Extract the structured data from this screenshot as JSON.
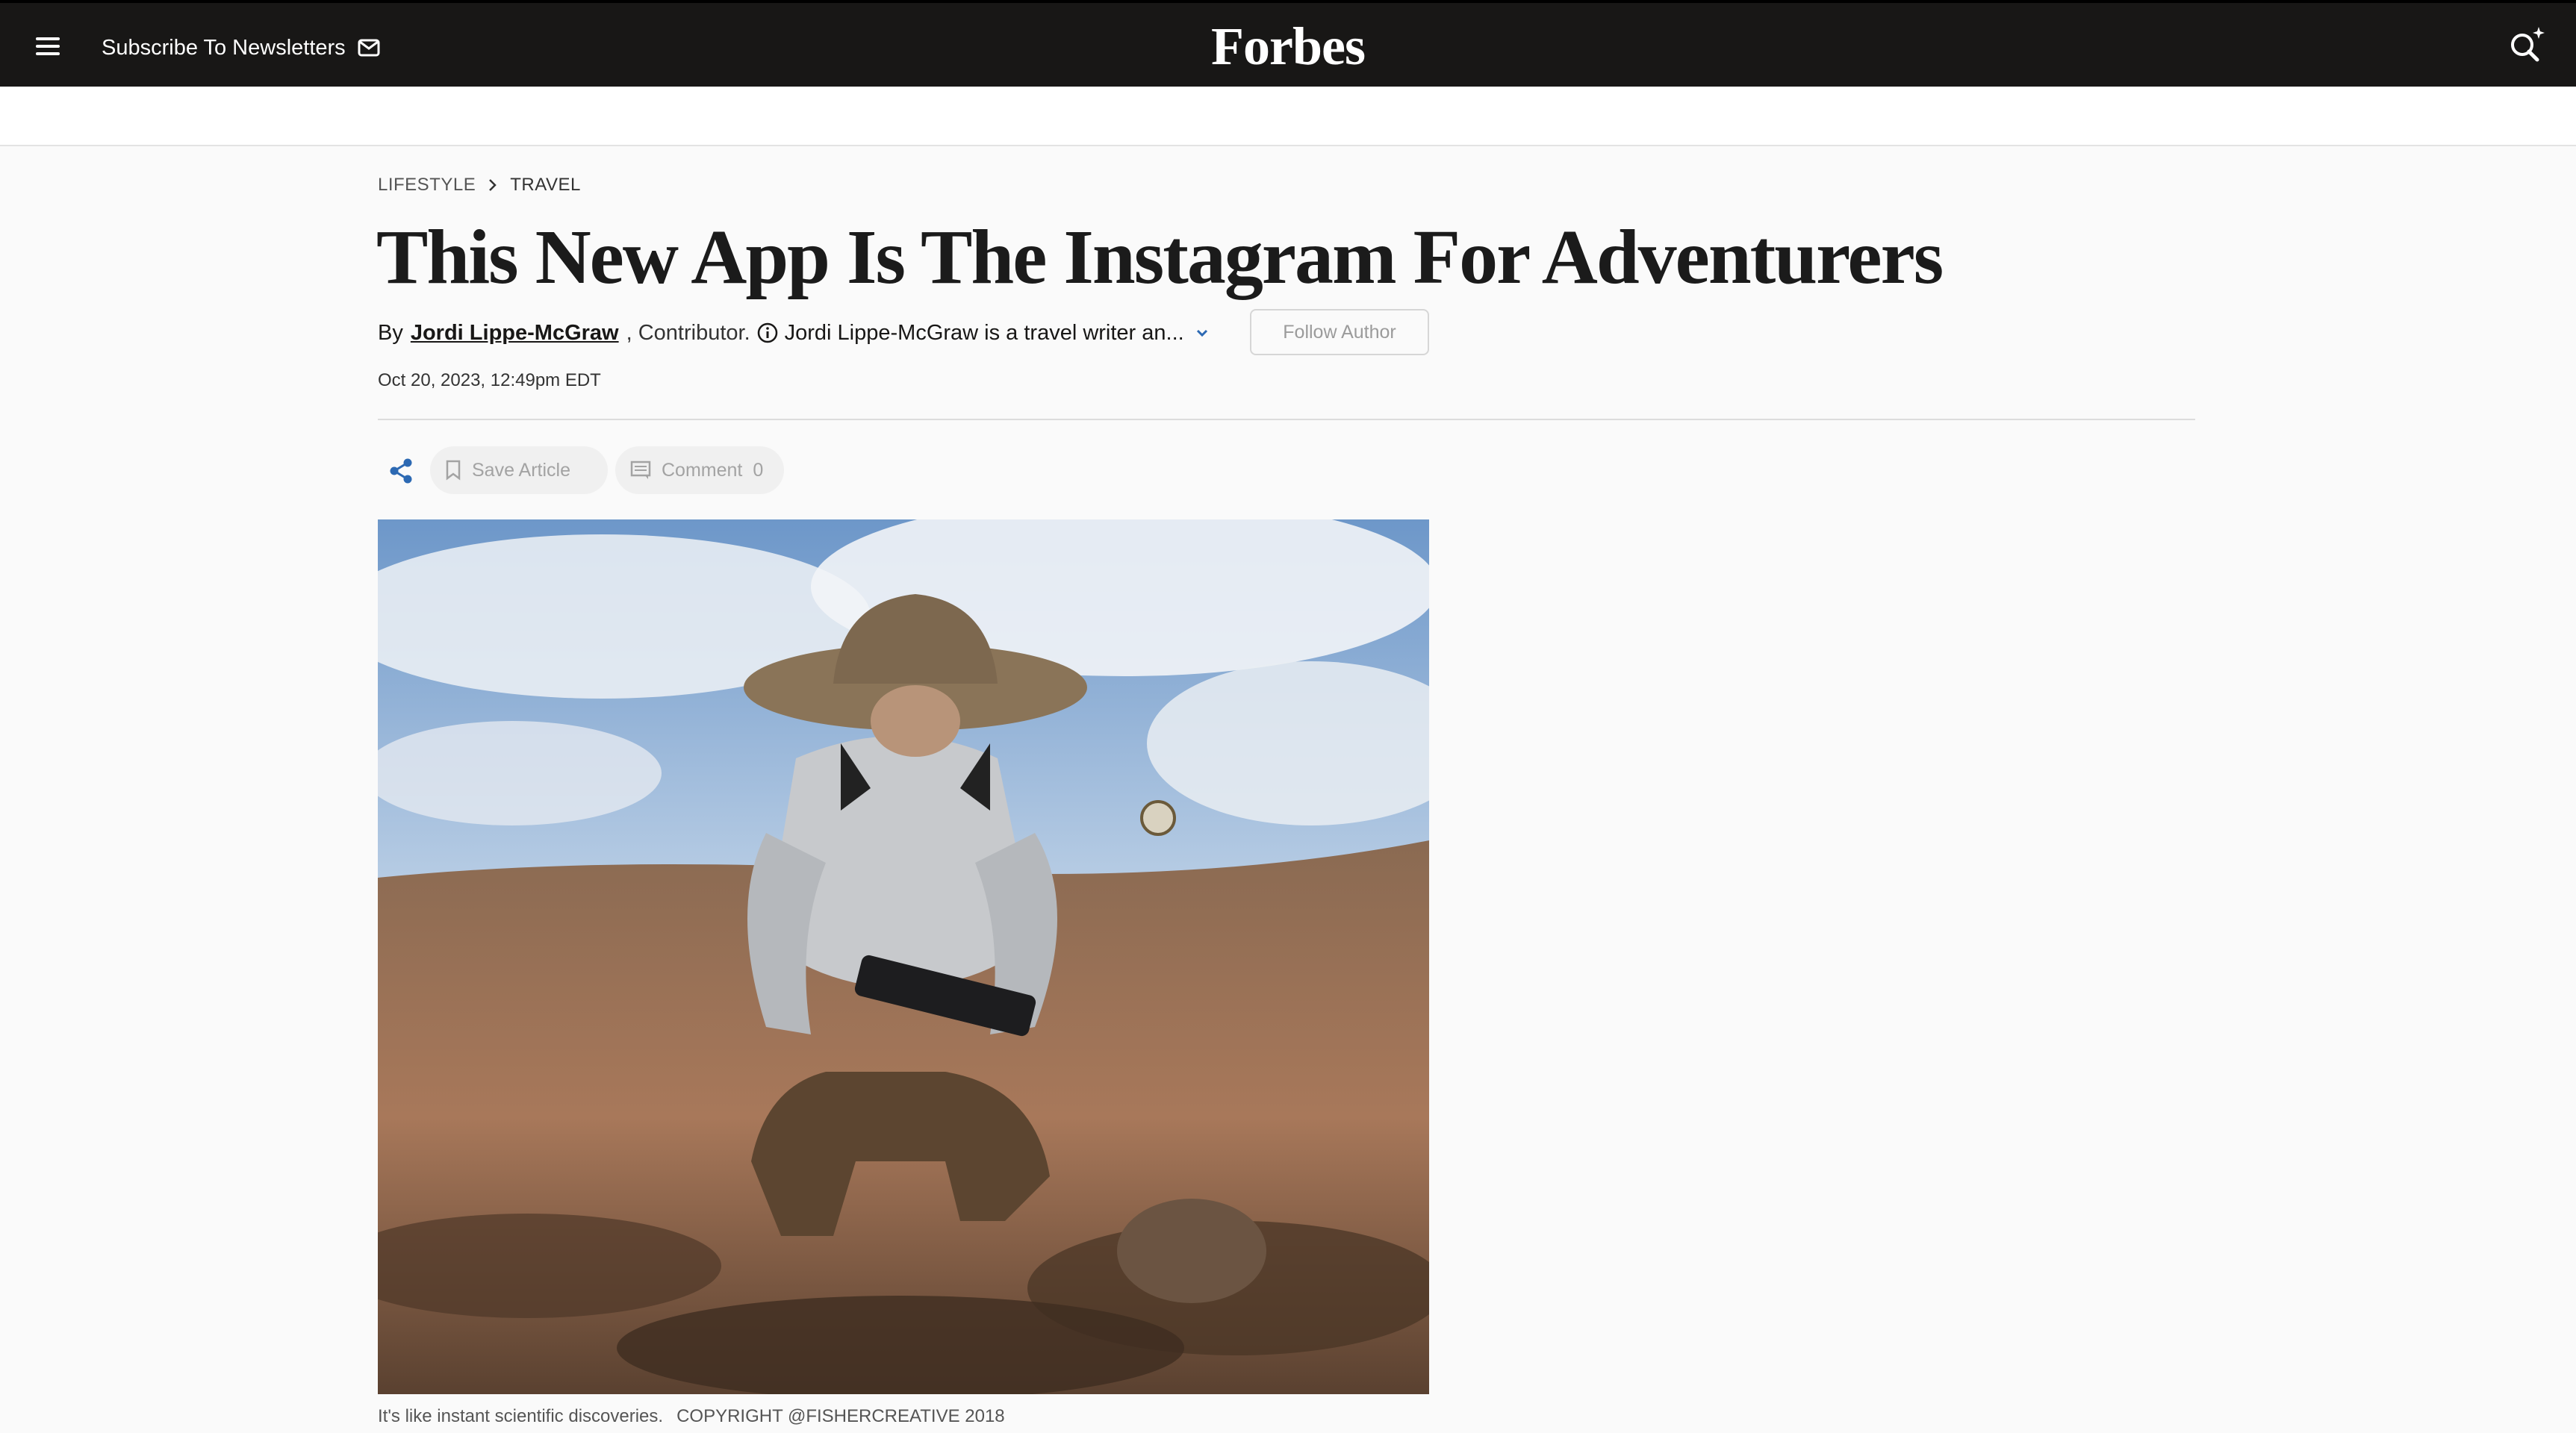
{
  "nav": {
    "subscribe_label": "Subscribe To Newsletters",
    "logo": "Forbes"
  },
  "breadcrumb": {
    "section": "LIFESTYLE",
    "subsection": "TRAVEL"
  },
  "article": {
    "title": "This New App Is The Instagram For Adventurers",
    "by": "By",
    "author": "Jordi Lippe-McGraw",
    "role": ", Contributor.",
    "bio": "Jordi Lippe-McGraw is a travel writer an...",
    "follow_label": "Follow Author",
    "date": "Oct 20, 2023, 12:49pm EDT"
  },
  "actions": {
    "save_label": "Save Article",
    "comment_label": "Comment",
    "comment_count": "0"
  },
  "image": {
    "caption": "It's like instant scientific discoveries.",
    "credit": "COPYRIGHT @FISHERCREATIVE 2018"
  },
  "colors": {
    "nav_bg": "#181716",
    "accent_blue": "#2c69b3",
    "page_bg": "#fafafa"
  }
}
